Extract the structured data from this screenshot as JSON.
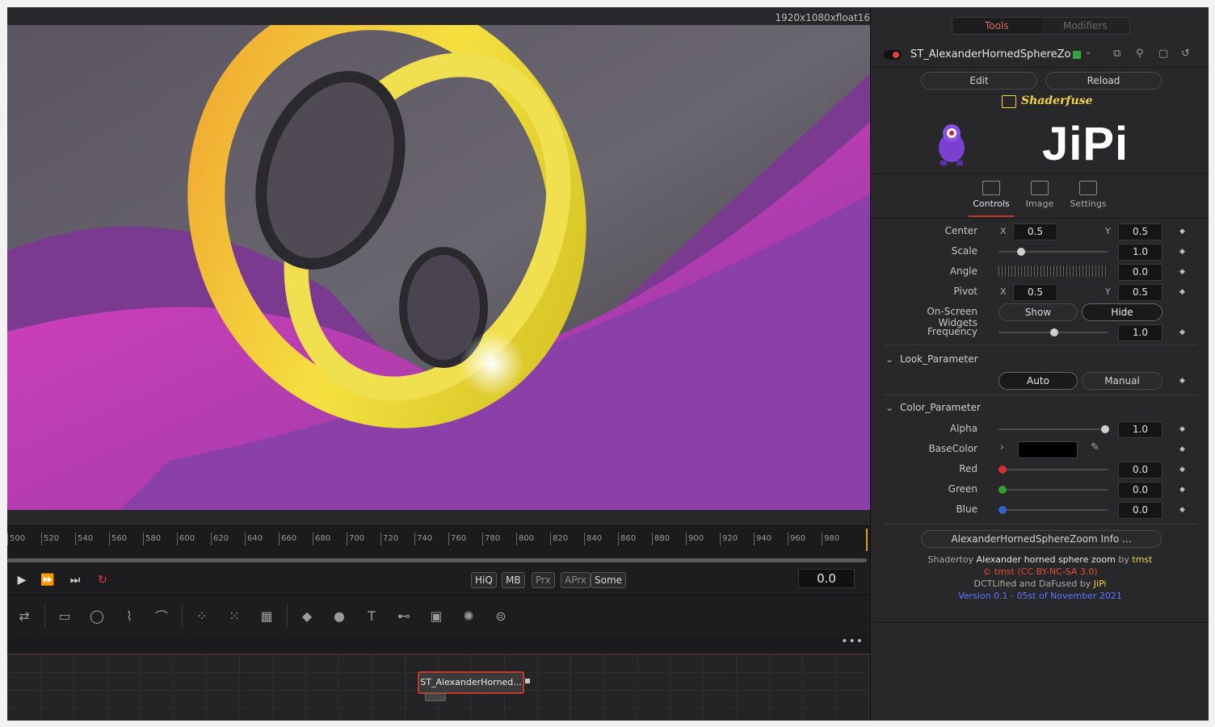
{
  "viewer": {
    "resolution": "1920x1080xfloat16"
  },
  "ruler": {
    "ticks": [
      "500",
      "520",
      "540",
      "560",
      "580",
      "600",
      "620",
      "640",
      "660",
      "680",
      "700",
      "720",
      "740",
      "760",
      "780",
      "800",
      "820",
      "840",
      "860",
      "880",
      "900",
      "920",
      "940",
      "960",
      "980"
    ]
  },
  "transport": {
    "quality_buttons": [
      "HiQ",
      "MB",
      "Prx",
      "APrx",
      "Some"
    ],
    "current_time": "0.0"
  },
  "node": {
    "label": "ST_AlexanderHorned..."
  },
  "inspector": {
    "tabs": {
      "tools": "Tools",
      "modifiers": "Modifiers"
    },
    "tool_name": "ST_AlexanderHornedSphereZo",
    "edit_label": "Edit",
    "reload_label": "Reload",
    "brand": "Shaderfuse",
    "logo_text": "JiPi",
    "panel_tabs": [
      "Controls",
      "Image",
      "Settings"
    ],
    "controls": {
      "center_label": "Center",
      "center_x": "0.5",
      "center_y": "0.5",
      "scale_label": "Scale",
      "scale": "1.0",
      "angle_label": "Angle",
      "angle": "0.0",
      "pivot_label": "Pivot",
      "pivot_x": "0.5",
      "pivot_y": "0.5",
      "widgets_label": "On-Screen Widgets",
      "widgets_show": "Show",
      "widgets_hide": "Hide",
      "frequency_label": "Frequency",
      "frequency": "1.0",
      "x_label": "X",
      "y_label": "Y"
    },
    "look": {
      "title": "Look_Parameter",
      "auto": "Auto",
      "manual": "Manual"
    },
    "color": {
      "title": "Color_Parameter",
      "alpha_label": "Alpha",
      "alpha": "1.0",
      "basecolor_label": "BaseColor",
      "red_label": "Red",
      "red": "0.0",
      "green_label": "Green",
      "green": "0.0",
      "blue_label": "Blue",
      "blue": "0.0"
    },
    "info_button": "AlexanderHornedSphereZoom Info ...",
    "credits": {
      "line1_prefix": "Shadertoy",
      "line1_title": "Alexander horned sphere zoom",
      "line1_by": "by",
      "line1_author": "tmst",
      "line2": "© tmst (CC BY-NC-SA 3.0)",
      "line3_prefix": "DCTLified and DaFused by",
      "line3_author": "JiPi",
      "line4": "Version 0.1 - 05st of November 2021"
    }
  },
  "colors": {
    "accent": "#c0392b",
    "brand_yellow": "#f5d44a",
    "version_blue": "#5a78ff",
    "license_red": "#e0503a"
  }
}
